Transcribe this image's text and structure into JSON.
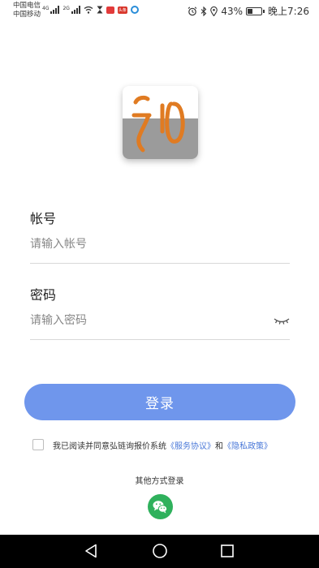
{
  "status_bar": {
    "carrier_1": "中国电信",
    "carrier_2": "中国移动",
    "net_1": "4G",
    "net_2": "2G",
    "app_badge": "头条",
    "battery_percent": "43%",
    "battery_level": 0.43,
    "time": "晚上7:26"
  },
  "logo": {
    "glyph": "和",
    "accent_color": "#e07b22"
  },
  "form": {
    "account_label": "帐号",
    "account_placeholder": "请输入帐号",
    "account_value": "",
    "password_label": "密码",
    "password_placeholder": "请输入密码",
    "password_value": "",
    "password_toggle_icon": "eye-closed-icon"
  },
  "login_button": {
    "label": "登录",
    "color": "#6f96ec"
  },
  "agreement": {
    "checked": false,
    "text_prefix": "我已阅读并同意弘链询报价系统",
    "terms_link": "《服务协议》",
    "conjunction": "和",
    "privacy_link": "《隐私政策》",
    "link_color": "#4a78d8"
  },
  "other_login": {
    "label": "其他方式登录",
    "wechat_icon": "wechat-icon",
    "wechat_color": "#2fb15c"
  },
  "nav_bar": {
    "back_icon": "back-triangle-icon",
    "home_icon": "home-circle-icon",
    "recents_icon": "recents-square-icon"
  }
}
